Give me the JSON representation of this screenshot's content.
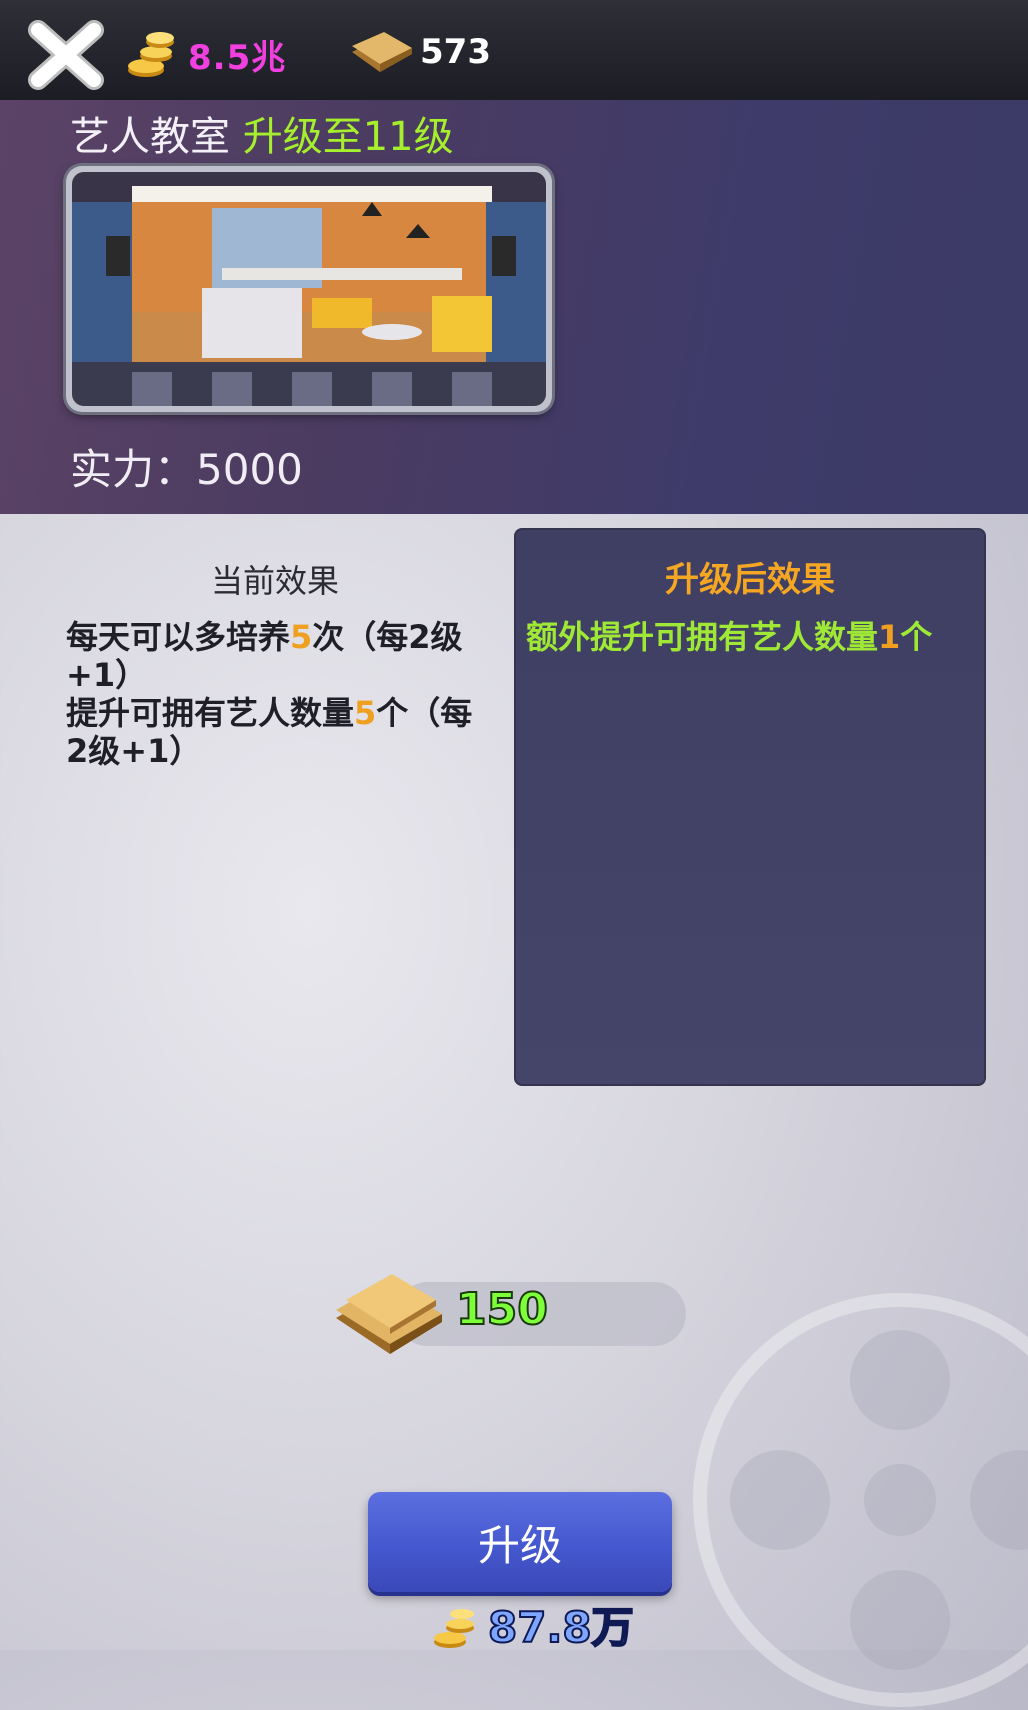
{
  "topbar": {
    "close_icon": "close-x-icon",
    "coin_amount": "8.5兆",
    "plank_amount": "573"
  },
  "header": {
    "room_name": "艺人教室",
    "upgrade_label": "升级至11级",
    "power_label": "实力：5000"
  },
  "current_effect": {
    "title": "当前效果",
    "line1_a": "每天可以多培养",
    "line1_num": "5",
    "line1_b": "次（每2级+1）",
    "line2_a": "提升可拥有艺人数量",
    "line2_num": "5",
    "line2_b": "个（每2级+1）"
  },
  "next_effect": {
    "title": "升级后效果",
    "text_a": "额外提升可拥有艺人数量",
    "text_num": "1",
    "text_b": "个"
  },
  "cost": {
    "plank_cost": "150"
  },
  "upgrade": {
    "button_label": "升级",
    "coin_cost": "87.8万"
  },
  "colors": {
    "coin_text": "#f040e0",
    "level_text": "#a6ef2c",
    "highlight": "#f0a020",
    "next_text": "#9fe835"
  }
}
